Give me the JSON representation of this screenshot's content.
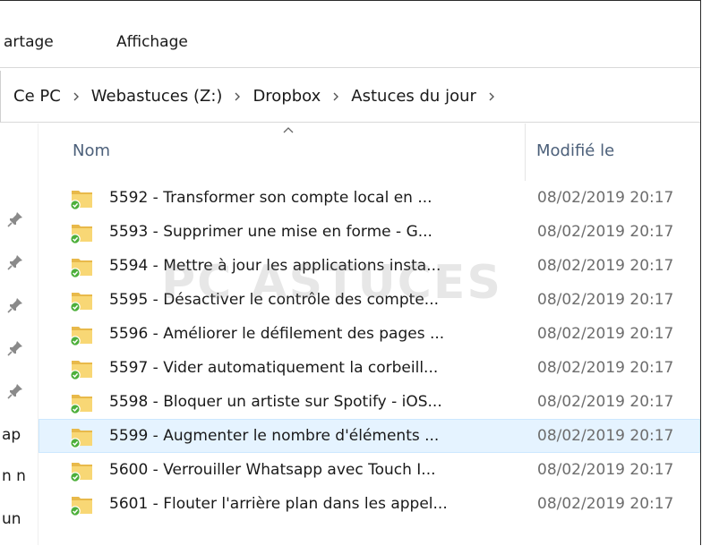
{
  "ribbon": {
    "tabs": [
      {
        "label": "artage"
      },
      {
        "label": "Affichage"
      }
    ]
  },
  "address": {
    "crumbs": [
      "Ce PC",
      "Webastuces (Z:)",
      "Dropbox",
      "Astuces du jour"
    ]
  },
  "navpane": {
    "labels": [
      "ap",
      "n n",
      "un"
    ]
  },
  "columns": {
    "name": "Nom",
    "modified": "Modifié le"
  },
  "files": [
    {
      "name": "5592 - Transformer son compte local en ...",
      "modified": "08/02/2019 20:17"
    },
    {
      "name": "5593 - Supprimer une mise en forme - G...",
      "modified": "08/02/2019 20:17"
    },
    {
      "name": "5594 - Mettre à jour les applications insta...",
      "modified": "08/02/2019 20:17"
    },
    {
      "name": "5595 - Désactiver le contrôle des compte...",
      "modified": "08/02/2019 20:17"
    },
    {
      "name": "5596 - Améliorer le défilement des pages ...",
      "modified": "08/02/2019 20:17"
    },
    {
      "name": "5597 - Vider automatiquement la corbeill...",
      "modified": "08/02/2019 20:17"
    },
    {
      "name": "5598 - Bloquer un artiste sur Spotify - iOS...",
      "modified": "08/02/2019 20:17"
    },
    {
      "name": "5599 - Augmenter le nombre d'éléments ...",
      "modified": "08/02/2019 20:17"
    },
    {
      "name": "5600 - Verrouiller Whatsapp avec Touch I...",
      "modified": "08/02/2019 20:17"
    },
    {
      "name": "5601 - Flouter l'arrière plan dans les appel...",
      "modified": "08/02/2019 20:17"
    }
  ],
  "watermark": "PC ASTUCES",
  "colors": {
    "folder": "#f8d775",
    "sync_check": "#4caf3a",
    "hover_row": "#e5f3ff",
    "header_text": "#4c607a"
  }
}
